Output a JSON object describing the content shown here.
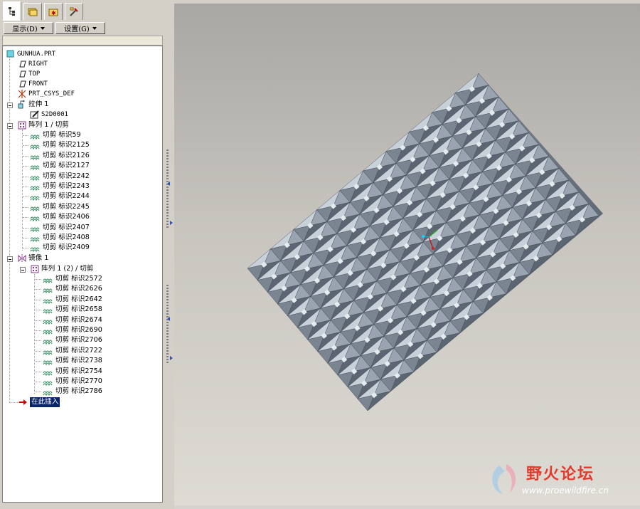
{
  "tabs": [
    {
      "icon": "model-tree-icon",
      "active": true
    },
    {
      "icon": "layer-folder-icon",
      "active": false
    },
    {
      "icon": "favorites-folder-icon",
      "active": false
    },
    {
      "icon": "tools-icon",
      "active": false
    }
  ],
  "toolbar": {
    "display_label": "显示(D)",
    "settings_label": "设置(G)"
  },
  "tree": {
    "root": "GUNHUA.PRT",
    "datums": [
      "RIGHT",
      "TOP",
      "FRONT"
    ],
    "csys": "PRT_CSYS_DEF",
    "extrude": "拉伸 1",
    "sketch": "S2D0001",
    "pattern1": "阵列 1 / 切剪",
    "pattern1_items": [
      "切剪 标识59",
      "切剪 标识2125",
      "切剪 标识2126",
      "切剪 标识2127",
      "切剪 标识2242",
      "切剪 标识2243",
      "切剪 标识2244",
      "切剪 标识2245",
      "切剪 标识2406",
      "切剪 标识2407",
      "切剪 标识2408",
      "切剪 标识2409"
    ],
    "mirror": "镜像 1",
    "pattern2": "阵列 1 (2) / 切剪",
    "pattern2_items": [
      "切剪 标识2572",
      "切剪 标识2626",
      "切剪 标识2642",
      "切剪 标识2658",
      "切剪 标识2674",
      "切剪 标识2690",
      "切剪 标识2706",
      "切剪 标识2722",
      "切剪 标识2738",
      "切剪 标识2754",
      "切剪 标识2770",
      "切剪 标识2786"
    ],
    "insert_here": "在此插入"
  },
  "watermark": {
    "title": "野火论坛",
    "url": "www.proewildfire.cn"
  },
  "colors": {
    "selection": "#0a246a",
    "model_light": "#b9c3cf",
    "model_dark": "#5a6470",
    "watermark_red": "#e23a2b"
  }
}
